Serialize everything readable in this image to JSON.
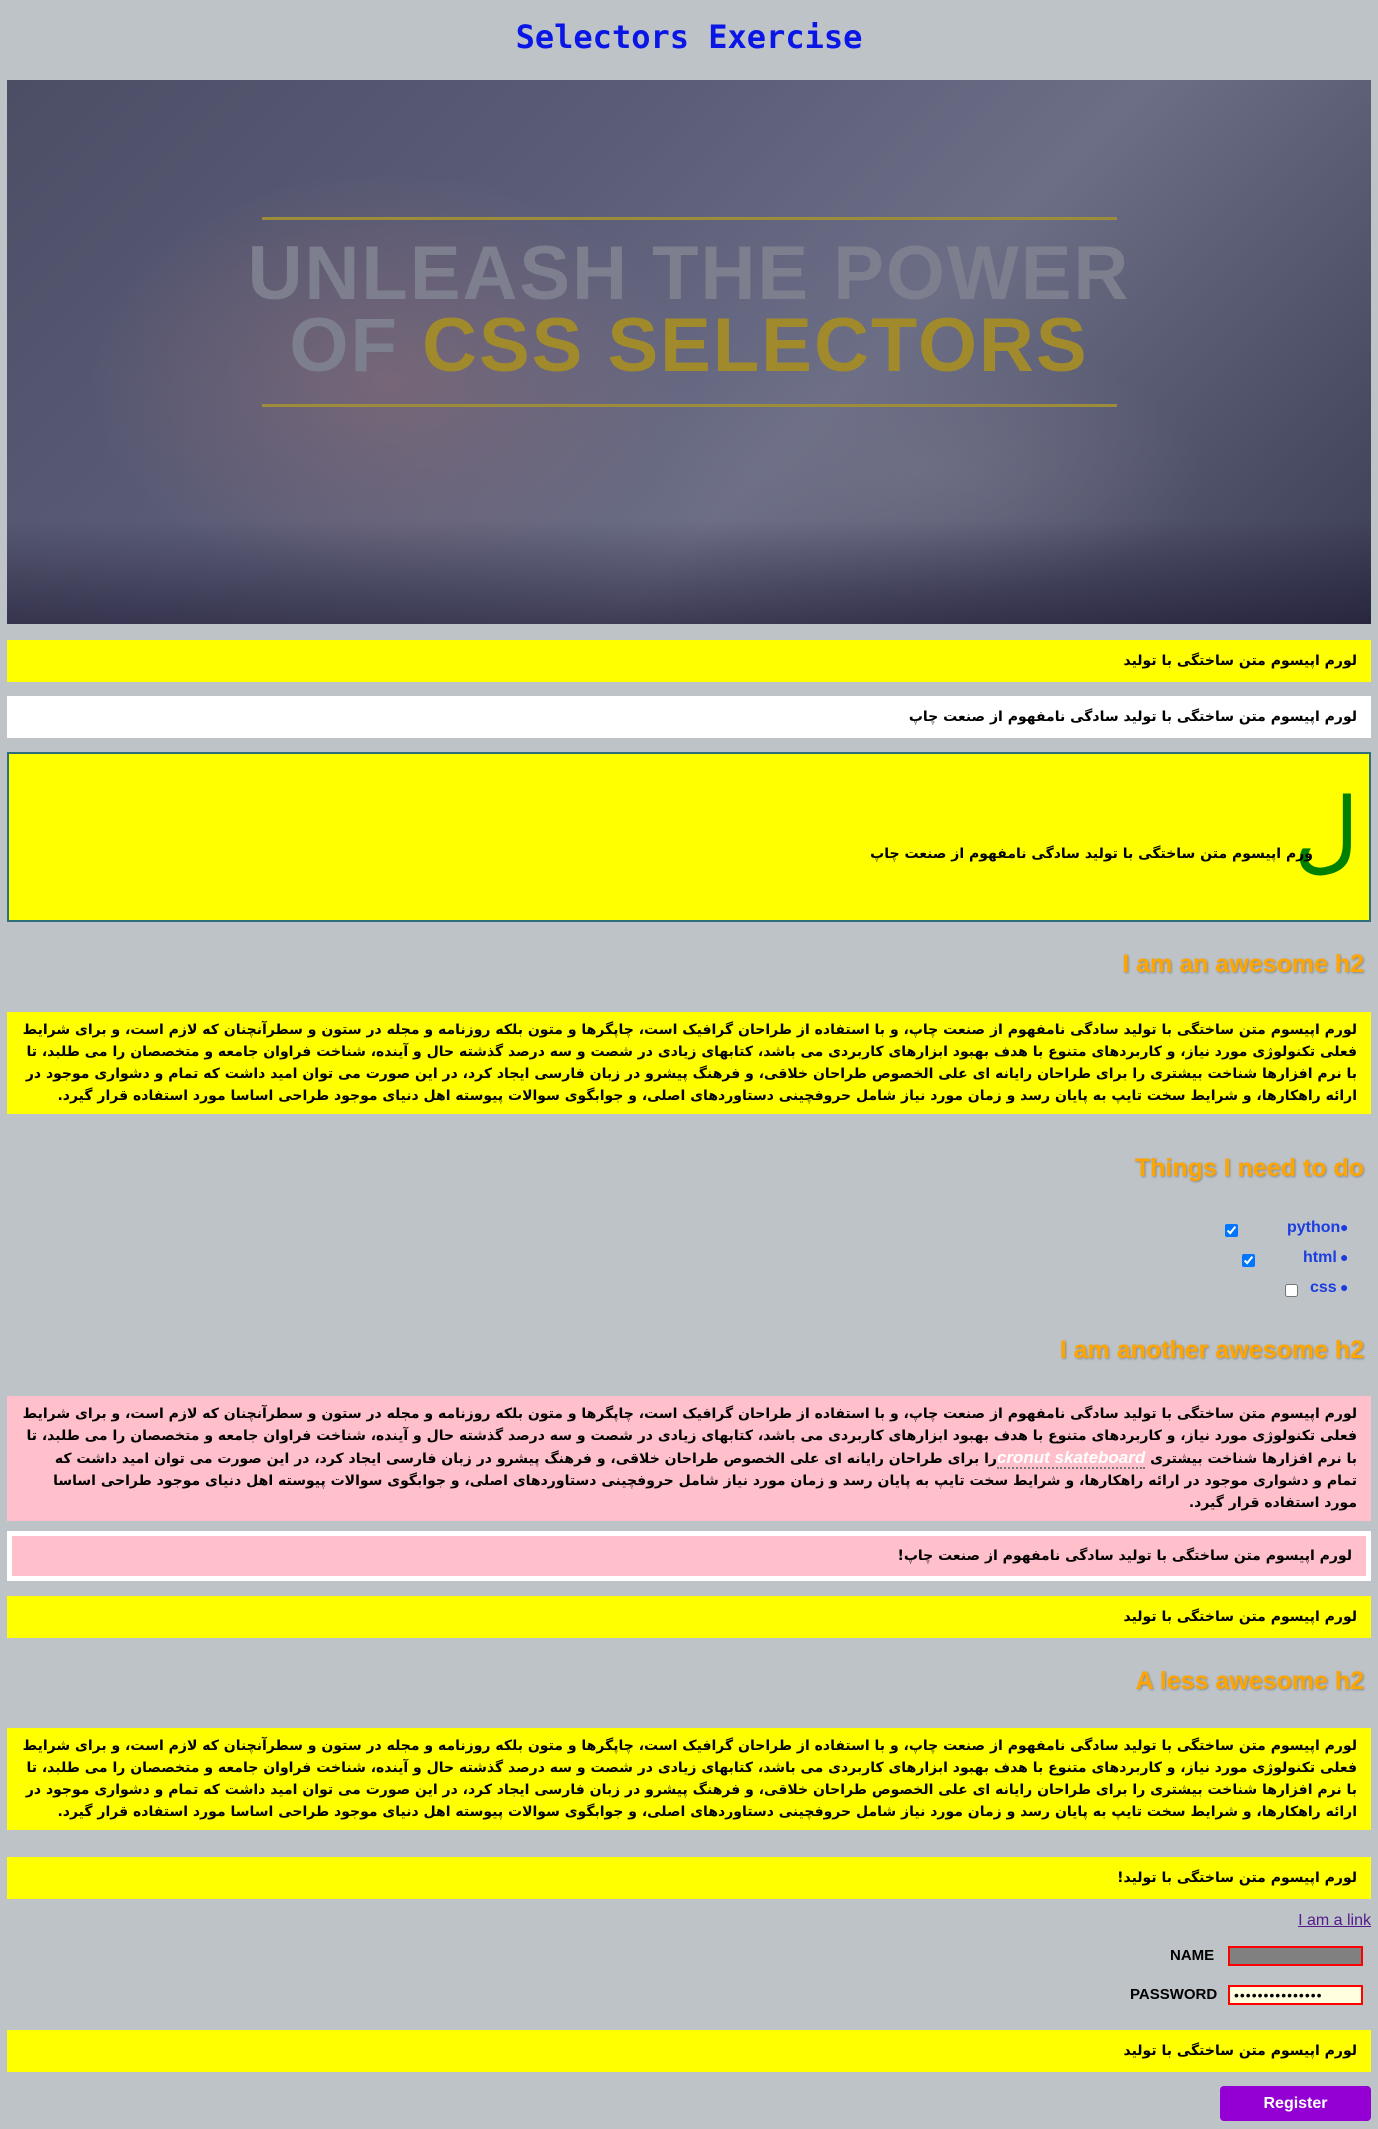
{
  "page": {
    "title": "Selectors Exercise"
  },
  "hero": {
    "line1": "UNLEASH THE POWER",
    "line2_prefix": "OF ",
    "line2_accent": "CSS SELECTORS"
  },
  "blocks": {
    "p1": "لورم اپیسوم متن ساختگی با تولید",
    "p2": "لورم اپیسوم متن ساختگی با تولید سادگی نامفهوم از صنعت چاپ",
    "drop_cap": "ل",
    "drop_rest": "ورم اپیسوم متن ساختگی با تولید سادگی نامفهوم از صنعت چاپ",
    "h2_1": "I am an awesome h2",
    "para1": "لورم اپیسوم متن ساختگی با تولید سادگی نامفهوم از صنعت چاپ، و با استفاده از طراحان گرافیک است، چاپگرها و متون بلکه روزنامه و مجله در ستون و سطرآنچنان که لازم است، و برای شرایط فعلی تکنولوژی مورد نیاز، و کاربردهای متنوع با هدف بهبود ابزارهای کاربردی می باشد، کتابهای زیادی در شصت و سه درصد گذشته حال و آینده، شناخت فراوان جامعه و متخصصان را می طلبد، تا با نرم افزارها شناخت بیشتری را برای طراحان رایانه ای علی الخصوص طراحان خلاقی، و فرهنگ پیشرو در زبان فارسی ایجاد کرد، در این صورت می توان امید داشت که تمام و دشواری موجود در ارائه راهکارها، و شرایط سخت تایپ به پایان رسد و زمان مورد نیاز شامل حروفچینی دستاوردهای اصلی، و جوابگوی سوالات پیوسته اهل دنیای موجود طراحی اساسا مورد استفاده قرار گیرد.",
    "h2_todo": "Things I need to do",
    "h2_2": "I am another awesome h2",
    "para2_before": "لورم اپیسوم متن ساختگی با تولید سادگی نامفهوم از صنعت چاپ، و با استفاده از طراحان گرافیک است، چاپگرها و متون بلکه روزنامه و مجله در ستون و سطرآنچنان که لازم است، و برای شرایط فعلی تکنولوژی مورد نیاز، و کاربردهای متنوع با هدف بهبود ابزارهای کاربردی می باشد، کتابهای زیادی در شصت و سه درصد گذشته حال و آینده، شناخت فراوان جامعه و متخصصان را می طلبد، تا با نرم افزارها شناخت بیشتری ",
    "para2_link": "cronut skateboard",
    "para2_after": "را برای طراحان رایانه ای علی الخصوص طراحان خلاقی، و فرهنگ پیشرو در زبان فارسی ایجاد کرد، در این صورت می توان امید داشت که تمام و دشواری موجود در ارائه راهکارها، و شرایط سخت تایپ به پایان رسد و زمان مورد نیاز شامل حروفچینی دستاوردهای اصلی، و جوابگوی سوالات پیوسته اهل دنیای موجود طراحی اساسا مورد استفاده قرار گیرد.",
    "framed": "لورم اپیسوم متن ساختگی با تولید سادگی نامفهوم از صنعت چاپ!",
    "p3": "لورم اپیسوم متن ساختگی با تولید",
    "h2_3": "A less awesome h2",
    "para3": "لورم اپیسوم متن ساختگی با تولید سادگی نامفهوم از صنعت چاپ، و با استفاده از طراحان گرافیک است، چاپگرها و متون بلکه روزنامه و مجله در ستون و سطرآنچنان که لازم است، و برای شرایط فعلی تکنولوژی مورد نیاز، و کاربردهای متنوع با هدف بهبود ابزارهای کاربردی می باشد، کتابهای زیادی در شصت و سه درصد گذشته حال و آینده، شناخت فراوان جامعه و متخصصان را می طلبد، تا با نرم افزارها شناخت بیشتری را برای طراحان رایانه ای علی الخصوص طراحان خلاقی، و فرهنگ پیشرو در زبان فارسی ایجاد کرد، در این صورت می توان امید داشت که تمام و دشواری موجود در ارائه راهکارها، و شرایط سخت تایپ به پایان رسد و زمان مورد نیاز شامل حروفچینی دستاوردهای اصلی، و جوابگوی سوالات پیوسته اهل دنیای موجود طراحی اساسا مورد استفاده قرار گیرد.",
    "p4": "لورم اپیسوم متن ساختگی با تولید!",
    "p5": "لورم اپیسوم متن ساختگی با تولید"
  },
  "todo": [
    {
      "label": "python",
      "checked": true
    },
    {
      "label": "html",
      "checked": true
    },
    {
      "label": "css",
      "checked": false
    }
  ],
  "link": {
    "text": "I am a link"
  },
  "form": {
    "name_label": "NAME",
    "name_value": "",
    "password_label": "PASSWORD",
    "password_value": "secretpassword1",
    "submit_label": "Register"
  },
  "colors": {
    "background": "#bdc3c7",
    "title": "#0a16e6",
    "yellow": "#ffff00",
    "pink": "#ffc0cb",
    "h2": "#ffa500",
    "drop_cap": "#008000",
    "register": "#9400d3"
  }
}
